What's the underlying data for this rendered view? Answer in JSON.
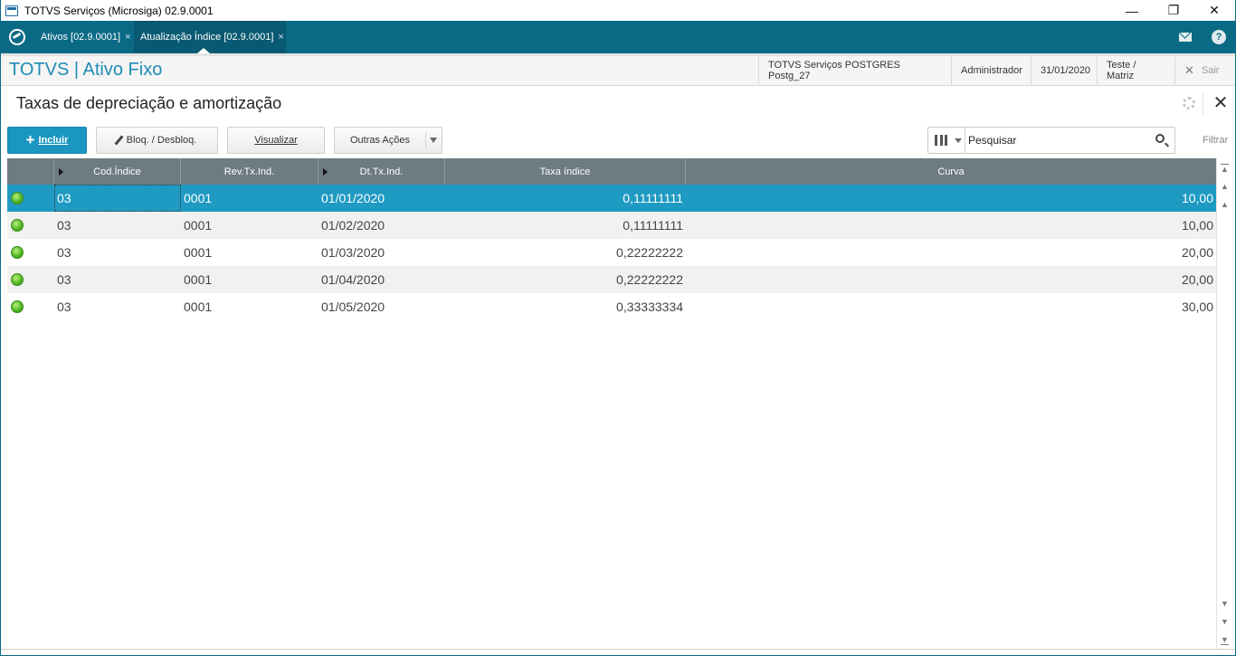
{
  "window": {
    "title": "TOTVS Serviços (Microsiga) 02.9.0001",
    "minimize": "—",
    "restore": "❐",
    "close": "✕"
  },
  "tabs": [
    {
      "label": "Ativos [02.9.0001]",
      "close": "×"
    },
    {
      "label": "Atualização Índice [02.9.0001]",
      "close": "×"
    }
  ],
  "tabbar_icons": [
    "mail-icon",
    "help-icon"
  ],
  "help_glyph": "?",
  "module": {
    "title": "TOTVS | Ativo Fixo",
    "environment": "TOTVS Serviços POSTGRES Postg_27",
    "user": "Administrador",
    "date": "31/01/2020",
    "branch": "Teste / Matriz",
    "exit_icon": "✕",
    "exit_label": "Sair"
  },
  "page": {
    "title": "Taxas de depreciação e amortização",
    "close_glyph": "✕"
  },
  "toolbar": {
    "include_plus": "+",
    "include_label": "Incluir",
    "block_label": "Bloq. / Desbloq.",
    "view_label": "Visualizar",
    "more_label": "Outras Ações",
    "search_placeholder": "Pesquisar",
    "filter_label": "Filtrar"
  },
  "grid": {
    "columns": [
      "",
      "Cod.Índice",
      "Rev.Tx.Ind.",
      "Dt.Tx.Ind.",
      "Taxa índice",
      "Curva"
    ],
    "rows": [
      {
        "status": "green",
        "cod": "03",
        "rev": "0001",
        "date": "01/01/2020",
        "taxa": "0,11111111",
        "curva": "10,00"
      },
      {
        "status": "green",
        "cod": "03",
        "rev": "0001",
        "date": "01/02/2020",
        "taxa": "0,11111111",
        "curva": "10,00"
      },
      {
        "status": "green",
        "cod": "03",
        "rev": "0001",
        "date": "01/03/2020",
        "taxa": "0,22222222",
        "curva": "20,00"
      },
      {
        "status": "green",
        "cod": "03",
        "rev": "0001",
        "date": "01/04/2020",
        "taxa": "0,22222222",
        "curva": "20,00"
      },
      {
        "status": "green",
        "cod": "03",
        "rev": "0001",
        "date": "01/05/2020",
        "taxa": "0,33333334",
        "curva": "30,00"
      }
    ],
    "selected_row": 0
  },
  "colors": {
    "accent": "#0a6a85",
    "selected_row": "#1f9ac2",
    "header": "#6d7b82",
    "status_green": "#4bb31f"
  }
}
